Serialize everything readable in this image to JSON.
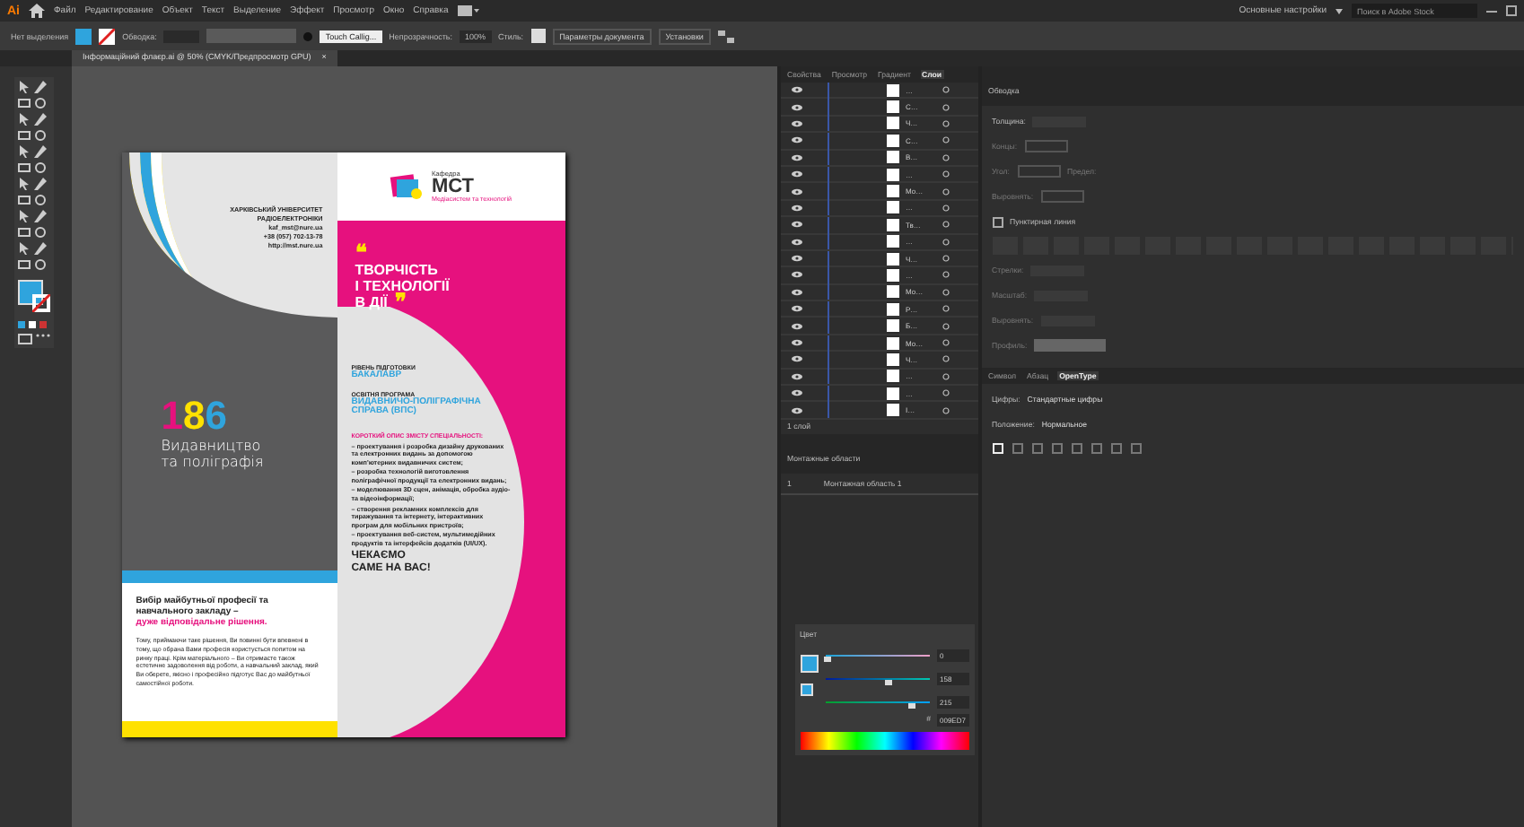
{
  "menu_bar": {
    "logo": "Ai",
    "items": [
      "Файл",
      "Редактирование",
      "Объект",
      "Текст",
      "Выделение",
      "Эффект",
      "Просмотр",
      "Окно",
      "Справка"
    ],
    "workspace": "Основные настройки",
    "search": {
      "placeholder": "Поиск в Adobe Stock"
    }
  },
  "control_bar": {
    "selection": "Нет выделения",
    "stroke_label": "Обводка:",
    "brush": "Touch Callig...",
    "opacity_label": "Непрозрачность:",
    "opacity": "100%",
    "style_label": "Стиль:",
    "buttons": [
      "Параметры документа",
      "Установки"
    ]
  },
  "document_tab": {
    "title": "Інформаційний флаєр.ai @ 50% (CMYK/Предпросмотр GPU)",
    "close": "×"
  },
  "flyer": {
    "contacts": [
      "ХАРКІВСЬКИЙ УНІВЕРСИТЕТ",
      "РАДІОЕЛЕКТРОНІКИ",
      "kaf_mst@nure.ua",
      "+38 (057) 702-13-78",
      "http://mst.nure.ua"
    ],
    "number": [
      {
        "text": "1",
        "color": "#e6117e"
      },
      {
        "text": "8",
        "color": "#ffe100"
      },
      {
        "text": "6",
        "color": "#2fa4dd"
      }
    ],
    "specialty": [
      "Видавництво",
      "та поліграфія"
    ],
    "headline": "Вибір майбутньої професії та навчального закладу –",
    "headline_accent": "дуже відповідальне рішення.",
    "paragraph": "Тому, приймаючи таке рішення, Ви повинні бути впевнені в тому, що обрана Вами професія користується попитом на ринку праці. Крім матеріального – Ви отримаєте також естетичне задоволення від роботи, а навчальний заклад, який Ви оберете, якісно і професійно підготує Вас до майбутньої самостійної роботи.",
    "logo": {
      "caption": "Кафедра",
      "name": "МСТ",
      "subtitle": "Медіасистем та технологій"
    },
    "open_quote": "❝",
    "slogan": [
      "ТВОРЧІСТЬ",
      "І ТЕХНОЛОГІЇ",
      "В ДІЇ"
    ],
    "close_quote": "❞",
    "facts": [
      {
        "label": "РІВЕНЬ ПІДГОТОВКИ",
        "value": "БАКАЛАВР"
      },
      {
        "label": "ОСВІТНЯ ПРОГРАМА",
        "value": "ВИДАВНИЧО-ПОЛІГРАФІЧНА СПРАВА (ВПС)"
      }
    ],
    "description_title": "КОРОТКИЙ ОПИС ЗМІСТУ СПЕЦІАЛЬНОСТІ:",
    "bullets": [
      "– проектування і розробка дизайну друкованих та електронних видань за допомогою комп'ютерних видавничих систем;",
      "– розробка технологій виготовлення поліграфічної продукції та електронних видань;",
      "– моделювання 3D сцен, анімація, обробка аудіо- та відеоінформації;",
      "– створення рекламних комплексів для тиражування та інтернету, інтерактивних програм для мобільних пристроїв;",
      "– проектування веб-систем, мультимедійних продуктів та інтерфейсів додатків (UI/UX)."
    ],
    "call": [
      "ЧЕКАЄМО",
      "САМЕ НА ВАС!"
    ]
  },
  "layers_panel": {
    "tabs": [
      {
        "label": "Свойства",
        "selected": false
      },
      {
        "label": "Просмотр",
        "selected": false
      },
      {
        "label": "Градиент",
        "selected": false
      },
      {
        "label": "Слои",
        "selected": true
      }
    ],
    "layers": [
      {
        "name": "…"
      },
      {
        "name": "С…"
      },
      {
        "name": "Ч…"
      },
      {
        "name": "С…"
      },
      {
        "name": "В…"
      },
      {
        "name": "…"
      },
      {
        "name": "Мо…"
      },
      {
        "name": "…"
      },
      {
        "name": "Тв…"
      },
      {
        "name": "…"
      },
      {
        "name": "Ч…"
      },
      {
        "name": "…"
      },
      {
        "name": "Мо…"
      },
      {
        "name": "Р…"
      },
      {
        "name": "Б…"
      },
      {
        "name": "Мо…"
      },
      {
        "name": "Ч…"
      },
      {
        "name": "…"
      },
      {
        "name": "…"
      },
      {
        "name": "І…"
      }
    ],
    "count": "1 слой"
  },
  "artboards_panel": {
    "title": "Монтажные области",
    "items": [
      {
        "number": "1",
        "name": "Монтажная область 1"
      }
    ]
  },
  "stroke_panel": {
    "title": "Обводка",
    "weight_label": "Толщина:",
    "rows": [
      "Концы:",
      "Угол:",
      "Выровнять:"
    ],
    "limit_label": "Предел:",
    "dashed_label": "Пунктирная линия",
    "dashed_checked": false,
    "rows2": [
      "Стрелки:",
      "Масштаб:",
      "Выровнять:"
    ],
    "profile_label": "Профиль:"
  },
  "type_panel": {
    "tabs": [
      {
        "label": "Символ",
        "selected": false
      },
      {
        "label": "Абзац",
        "selected": false
      },
      {
        "label": "OpenType",
        "selected": true
      }
    ],
    "rows": [
      {
        "label": "Цифры:",
        "value": "Стандартные цифры"
      },
      {
        "label": "Положение:",
        "value": "Нормальное"
      }
    ]
  },
  "color_panel": {
    "title": "Цвет",
    "channels": [
      {
        "kind": "red",
        "value": "0",
        "level": 0.02
      },
      {
        "kind": "green",
        "value": "158",
        "level": 0.62
      },
      {
        "kind": "blue",
        "value": "215",
        "level": 0.84
      }
    ],
    "hex_label": "#",
    "hex": "009ED7"
  }
}
